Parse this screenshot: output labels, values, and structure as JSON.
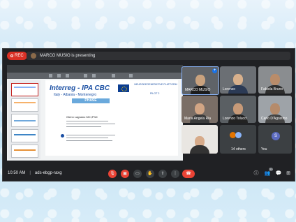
{
  "recording_label": "REC",
  "presenting_text": "MARCO MUSIO is presenting",
  "slide": {
    "logo": "Interreg - IPA CBC",
    "countries": "Italy - Albania - Montenegro",
    "phase": "PHASE",
    "right_title": "NEURODEGENERATIVE PLATFORM",
    "right_sub": "PILOT 2",
    "speaker": "Glenn Lagnano MCI,PhD"
  },
  "participants": [
    {
      "name": "MARCO MUSIO"
    },
    {
      "name": "Lorenzo"
    },
    {
      "name": "Fabiola Bruno"
    },
    {
      "name": "Maria Angela Ria"
    },
    {
      "name": "Lorenzo Tolucci"
    },
    {
      "name": "Carlo D'Agostino"
    },
    {
      "name": ""
    },
    {
      "name": "14 others"
    },
    {
      "name": "You",
      "initial": "S"
    }
  ],
  "meeting": {
    "time": "10:50 AM",
    "code": "ads-ebgp-raxg"
  },
  "badge_count": "23",
  "colors": {
    "accent_red": "#ea4335",
    "bar_bg": "#202124",
    "blue": "#1a73e8"
  }
}
